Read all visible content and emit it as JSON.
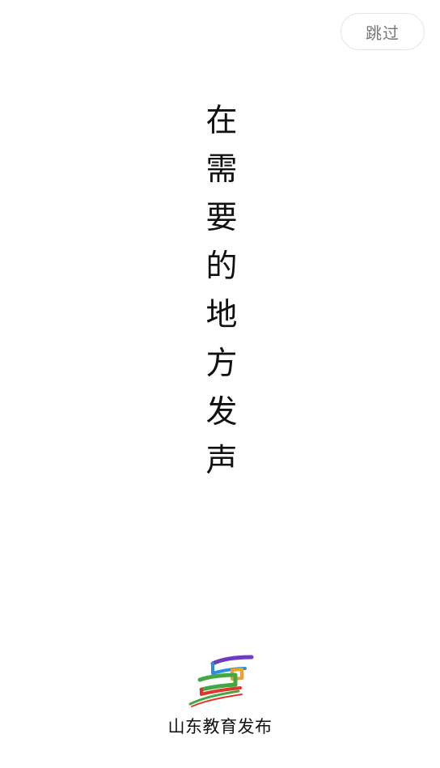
{
  "skip_button": {
    "label": "跳过"
  },
  "slogan": {
    "characters": [
      "在",
      "需",
      "要",
      "的",
      "地",
      "方",
      "发",
      "声"
    ]
  },
  "brand": {
    "logo_icon": "shandong-education-logo-icon",
    "name": "山东教育发布",
    "logo_colors": [
      "#6e3dbf",
      "#2a8fe0",
      "#f0a02a",
      "#43a843",
      "#e2342b",
      "#ffffff"
    ]
  }
}
